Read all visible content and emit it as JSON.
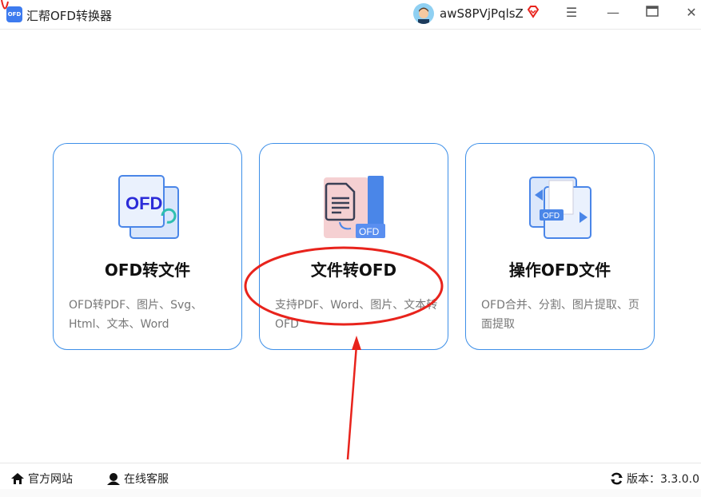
{
  "titlebar": {
    "logo_text": "OFD",
    "app_title": "汇帮OFD转换器",
    "username": "awS8PVjPqlsZ",
    "icons": [
      "vip-diamond-icon",
      "menu-icon",
      "minimize-icon",
      "maximize-icon",
      "close-icon"
    ]
  },
  "cards": [
    {
      "title": "OFD转文件",
      "desc": "OFD转PDF、图片、Svg、Html、文本、Word",
      "icon": "ofd-to-file-icon"
    },
    {
      "title": "文件转OFD",
      "desc": "支持PDF、Word、图片、文本转OFD",
      "icon": "file-to-ofd-icon"
    },
    {
      "title": "操作OFD文件",
      "desc": "OFD合并、分割、图片提取、页面提取",
      "icon": "ofd-operate-icon"
    }
  ],
  "footer": {
    "website": "官方网站",
    "support": "在线客服",
    "version": "版本：3.3.0.0"
  },
  "colors": {
    "accent": "#3d8fe8",
    "annotation": "#e8231c"
  }
}
